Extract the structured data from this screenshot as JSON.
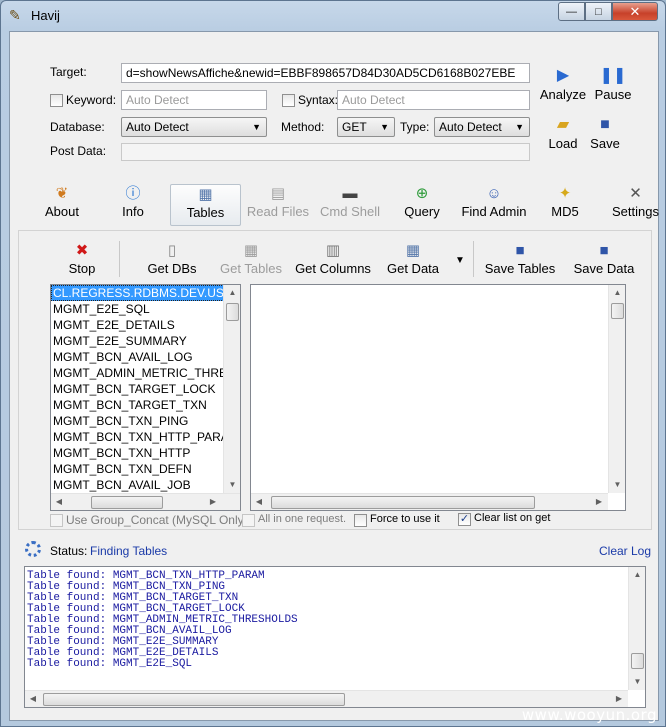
{
  "window": {
    "title": "Havij",
    "minimize": "—",
    "maximize": "□",
    "close": "✕"
  },
  "form": {
    "target_label": "Target:",
    "target_value": "d=showNewsAffiche&newid=EBBF898657D84D30AD5CD6168B027EBE",
    "keyword_label": "Keyword:",
    "keyword_placeholder": "Auto Detect",
    "syntax_label": "Syntax:",
    "syntax_placeholder": "Auto Detect",
    "database_label": "Database:",
    "database_value": "Auto Detect",
    "method_label": "Method:",
    "method_value": "GET",
    "type_label": "Type:",
    "type_value": "Auto Detect",
    "postdata_label": "Post Data:"
  },
  "side_buttons": {
    "analyze": "Analyze",
    "pause": "Pause",
    "load": "Load",
    "save": "Save"
  },
  "tabs": [
    {
      "label": "About"
    },
    {
      "label": "Info"
    },
    {
      "label": "Tables"
    },
    {
      "label": "Read Files"
    },
    {
      "label": "Cmd Shell"
    },
    {
      "label": "Query"
    },
    {
      "label": "Find Admin"
    },
    {
      "label": "MD5"
    },
    {
      "label": "Settings"
    }
  ],
  "toolbar": {
    "stop": "Stop",
    "get_dbs": "Get DBs",
    "get_tables": "Get Tables",
    "get_columns": "Get Columns",
    "get_data": "Get Data",
    "save_tables": "Save Tables",
    "save_data": "Save Data"
  },
  "tables_list": [
    "CL.REGRESS.RDBMS.DEV.US.O",
    "MGMT_E2E_SQL",
    "MGMT_E2E_DETAILS",
    "MGMT_E2E_SUMMARY",
    "MGMT_BCN_AVAIL_LOG",
    "MGMT_ADMIN_METRIC_THRES",
    "MGMT_BCN_TARGET_LOCK",
    "MGMT_BCN_TARGET_TXN",
    "MGMT_BCN_TXN_PING",
    "MGMT_BCN_TXN_HTTP_PARAM",
    "MGMT_BCN_TXN_HTTP",
    "MGMT_BCN_TXN_DEFN",
    "MGMT_BCN_AVAIL_JOB"
  ],
  "options": {
    "group_concat": "Use Group_Concat (MySQL Only)",
    "all_in_one": "All in one request.",
    "force": "Force to use it",
    "clear_list": "Clear list on get",
    "clear_list_checked": "✓"
  },
  "status": {
    "label": "Status:",
    "value": "Finding Tables",
    "clear_log": "Clear Log"
  },
  "log_lines": [
    "Table found: MGMT_BCN_TXN_HTTP_PARAM",
    "Table found: MGMT_BCN_TXN_PING",
    "Table found: MGMT_BCN_TARGET_TXN",
    "Table found: MGMT_BCN_TARGET_LOCK",
    "Table found: MGMT_ADMIN_METRIC_THRESHOLDS",
    "Table found: MGMT_BCN_AVAIL_LOG",
    "Table found: MGMT_E2E_SUMMARY",
    "Table found: MGMT_E2E_DETAILS",
    "Table found: MGMT_E2E_SQL"
  ],
  "watermark": "www.wooyun.org"
}
